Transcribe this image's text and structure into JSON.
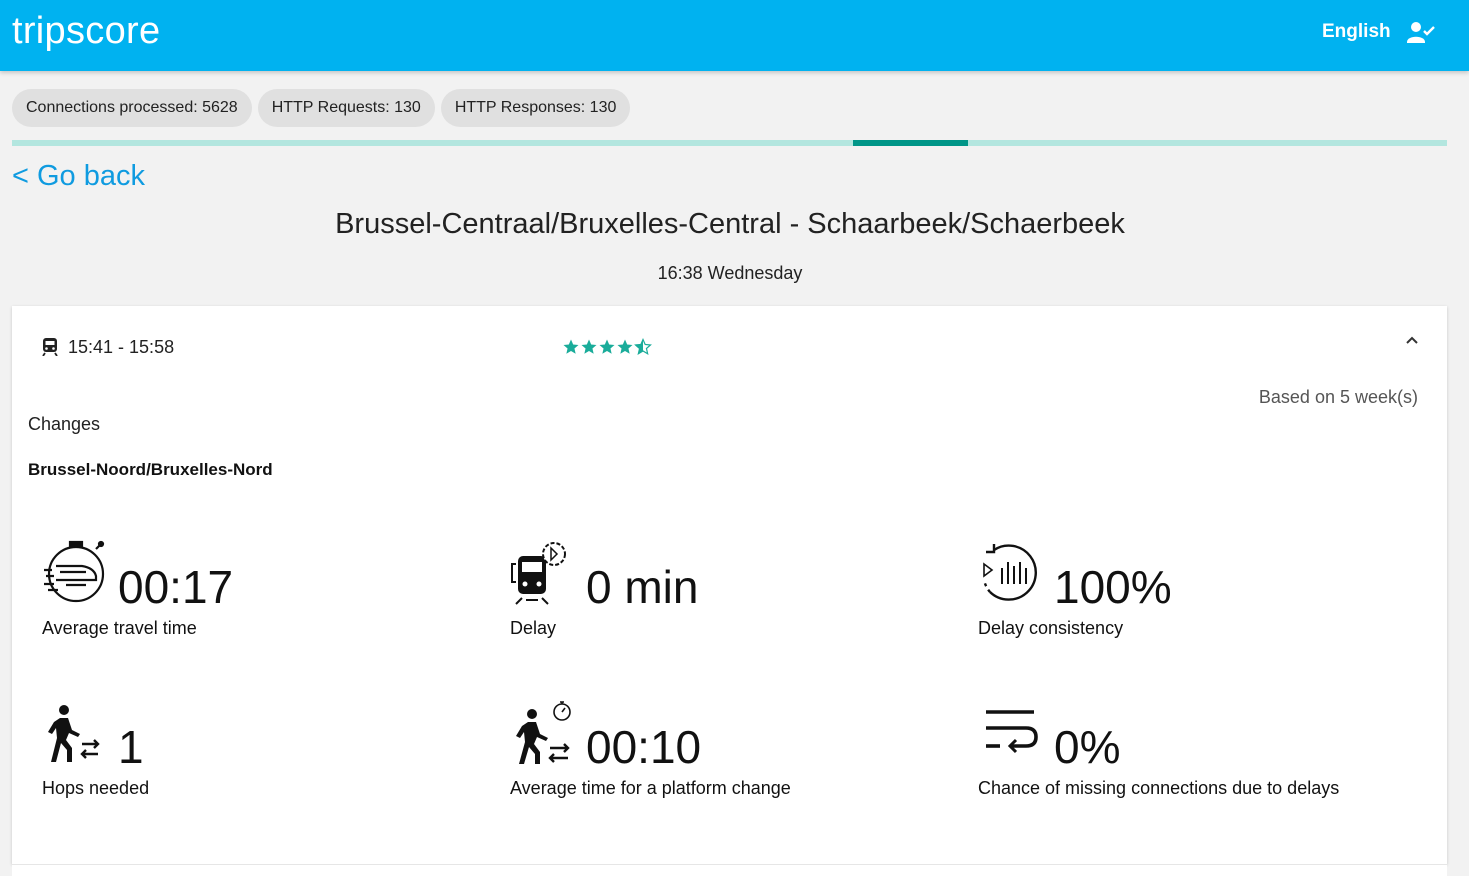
{
  "app": {
    "brand": "tripscore",
    "language": "English"
  },
  "stats": [
    {
      "label": "Connections processed: 5628"
    },
    {
      "label": "HTTP Requests: 130"
    },
    {
      "label": "HTTP Responses: 130"
    }
  ],
  "progress": {
    "segment_start": 0.586,
    "segment_end": 0.666
  },
  "nav": {
    "back_label": "< Go back"
  },
  "route": {
    "title": "Brussel-Centraal/Bruxelles-Central - Schaarbeek/Schaerbeek",
    "time": "16:38 Wednesday"
  },
  "journey": {
    "time_range": "15:41 - 15:58",
    "rating": 4.5,
    "based_on": "Based on 5 week(s)",
    "changes_label": "Changes",
    "change_station": "Brussel-Noord/Bruxelles-Nord",
    "accent_color": "#1aac9a"
  },
  "metrics": [
    {
      "icon": "stopwatch-train-icon",
      "value": "00:17",
      "label": "Average travel time"
    },
    {
      "icon": "train-delay-icon",
      "value": "0 min",
      "label": "Delay"
    },
    {
      "icon": "consistency-chart-icon",
      "value": "100%",
      "label": "Delay consistency"
    },
    {
      "icon": "walking-transfer-icon",
      "value": "1",
      "label": "Hops needed"
    },
    {
      "icon": "platform-change-timer-icon",
      "value": "00:10",
      "label": "Average time for a platform change"
    },
    {
      "icon": "wrap-return-icon",
      "value": "0%",
      "label": "Chance of missing connections due to delays"
    }
  ]
}
